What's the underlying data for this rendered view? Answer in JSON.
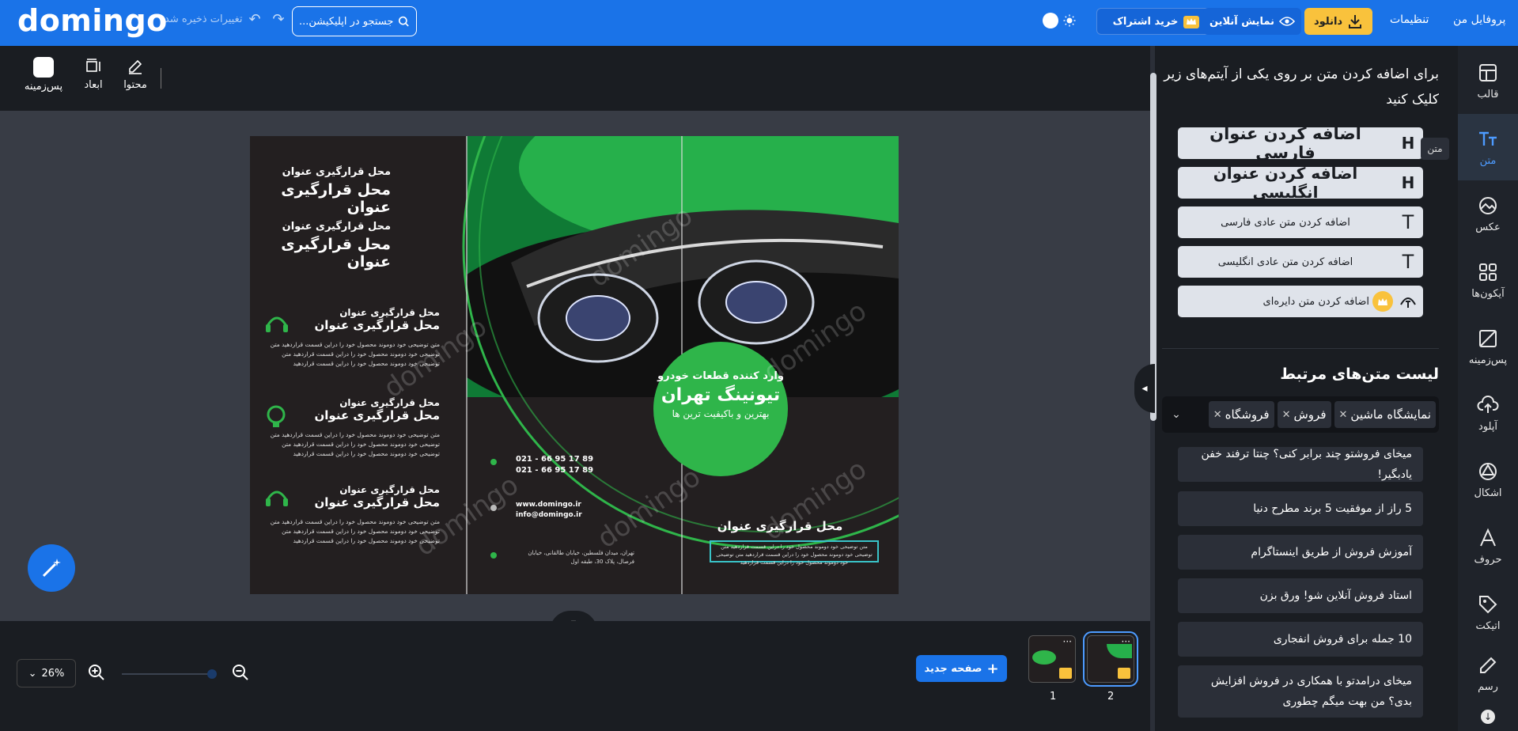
{
  "topbar": {
    "logo": "domingo",
    "save_status": "تغییرات ذخیره شد",
    "search_text": "جستجو در اپلیکیشن...",
    "subscribe_label": "خرید اشتراک",
    "online_label": "نمایش آنلاین",
    "download_label": "دانلود",
    "settings_label": "تنظیمات",
    "profile_label": "پروفایل من"
  },
  "canvas_toolbar": {
    "background_label": "پس‌زمینه",
    "dimensions_label": "ابعاد",
    "content_label": "محتوا"
  },
  "sidebar": {
    "items": [
      {
        "label": "قالب",
        "icon": "template-icon"
      },
      {
        "label": "متن",
        "icon": "text-icon",
        "active": true
      },
      {
        "label": "عکس",
        "icon": "image-icon"
      },
      {
        "label": "آیکون‌ها",
        "icon": "icons-icon"
      },
      {
        "label": "پس‌زمینه",
        "icon": "background-icon"
      },
      {
        "label": "آپلود",
        "icon": "upload-icon"
      },
      {
        "label": "اشکال",
        "icon": "shapes-icon"
      },
      {
        "label": "حروف",
        "icon": "letters-icon"
      },
      {
        "label": "اتیکت",
        "icon": "tag-icon"
      },
      {
        "label": "رسم",
        "icon": "pencil-icon"
      }
    ],
    "tooltip": "متن"
  },
  "text_panel": {
    "hint": "برای اضافه کردن متن بر روی یکی از آیتم‌های زیر کلیک کنید",
    "add_items": [
      {
        "label": "اضافه کردن عنوان فارسی",
        "icon": "heading-icon"
      },
      {
        "label": "اضافه کردن عنوان انگلیسی",
        "icon": "heading-icon"
      },
      {
        "label": "اضافه کردن متن عادی فارسی",
        "icon": "text-icon"
      },
      {
        "label": "اضافه کردن متن عادی انگلیسی",
        "icon": "text-icon"
      },
      {
        "label": "اضافه کردن متن دایره‌ای",
        "icon": "curved-text-icon"
      }
    ],
    "related_title": "لیست متن‌های مرتبط",
    "tags": [
      "نمایشگاه ماشین",
      "فروش",
      "فروشگاه"
    ],
    "related_items": [
      "میخای فروشتو چند برابر کنی؟ چنتا ترفند خفن یادبگیر!",
      "5 راز از موفقیت 5 برند مطرح دنیا",
      "آموزش فروش از طریق اینستاگرام",
      "استاد فروش آنلاین شو! ورق بزن",
      "10 جمله برای فروش انفجاری",
      "میخای درامدتو با همکاری در فروش افزایش بدی؟ من بهت میگم چطوری"
    ]
  },
  "design": {
    "title_small": "محل قرارگیری عنوان",
    "title_large": "محل قرارگیری عنوان",
    "body_text": "متن توضیحی خود دوموند محصول خود را دراین قسمت قراردهید متن توضیحی خود دوموند محصول خود را دراین قسمت قراردهید متن توضیحی خود دوموند محصول خود را دراین قسمت قراردهید",
    "phone1": "021 - 66 95 17 89",
    "phone2": "021 - 66 95 17 89",
    "website": "www.domingo.ir",
    "email": "info@domingo.ir",
    "address": "تهران، میدان فلسطین، خیابان طالقانی، خیابان فرصال، پلاک 30، طبقه اول",
    "circle_line1": "وارد کننده قطعات خودرو",
    "circle_line2": "تیونینگ تهران",
    "circle_line3": "بهترین و باکیفیت ترین ها",
    "watermark": "domingo",
    "accent": "#2fb54a"
  },
  "bottombar": {
    "zoom": "26%",
    "new_page_label": "صفحه جدید",
    "pages": [
      "1",
      "2"
    ]
  }
}
